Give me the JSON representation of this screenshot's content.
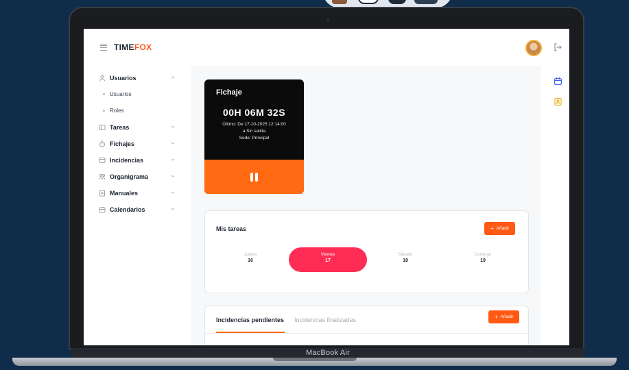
{
  "app": {
    "logo_part1": "TIME",
    "logo_part2": "FOX",
    "laptop_label": "MacBook Air"
  },
  "sidebar": {
    "usuarios": "Usuarios",
    "usuarios_sub": [
      "Usuarios",
      "Roles"
    ],
    "tareas": "Tareas",
    "fichajes": "Fichajes",
    "incidencias": "Incidencias",
    "organigrama": "Organigrama",
    "manuales": "Manuales",
    "calendarios": "Calendarios"
  },
  "fichaje": {
    "title": "Fichaje",
    "time": "00H 06M 32S",
    "last_line": "Último: De 17-10-2025 12:14:00",
    "exit_line": "a Sin salida",
    "sede_line": "Sede: Principal"
  },
  "tasks": {
    "title": "Mis tareas",
    "add_label": "Añadir",
    "days": [
      {
        "name": "Jueves",
        "num": "16"
      },
      {
        "name": "Viernes",
        "num": "17"
      },
      {
        "name": "Sábado",
        "num": "18"
      },
      {
        "name": "Domingo",
        "num": "19"
      }
    ],
    "active_index": 1
  },
  "incidents": {
    "tab_pending": "Incidencias pendientes",
    "tab_done": "Incidencias finalizadas",
    "add_label": "Añadir"
  },
  "colors": {
    "accent": "#ff5a13",
    "day_active": "#ff2d55",
    "page_bg": "#0f2d4a"
  }
}
